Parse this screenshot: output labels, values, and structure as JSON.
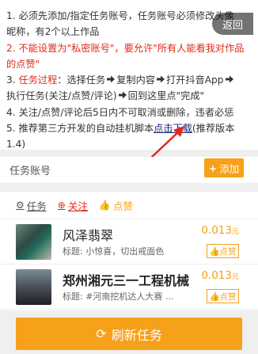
{
  "notice": {
    "line1_a": "1. 必须先添加/指定任务账号，任务账号必须修改头像",
    "line1_b": "昵称，有2个以上作品",
    "line2_a": "2. 不能设置为\"私密账号\"，要允许\"所有人能看我对作品",
    "line2_b": "的点赞\"",
    "line3_prefix": "3. ",
    "line3_tag": "任务过程",
    "line3_a": "：选择任务",
    "line3_b": "复制内容",
    "line3_c": "打开抖音App",
    "line4_a": "执行任务(关注/点赞/评论)",
    "line4_b": "回到这里点\"完成\"",
    "line5": "4. 关注/点赞/评论后5日内不可取消或删除，违者必惩",
    "line6_a": "5. 推荐第三方开发的自动挂机脚本",
    "line6_link": "点击下载",
    "line6_b": "(推荐版本",
    "line7": "1.4)"
  },
  "back_label": "返回",
  "account": {
    "title": "任务账号",
    "add_label": "添加"
  },
  "tabs": {
    "task": "任务",
    "follow": "关注",
    "like": "点赞"
  },
  "tasks": [
    {
      "title": "风泽翡翠",
      "subtitle": "标题: 小惊喜，切出戒面色",
      "price": "0.013",
      "unit": "元",
      "action": "点赞"
    },
    {
      "title": "郑州湘元三一工程机械",
      "subtitle": "标题: #河南挖机达人大赛 ...",
      "price": "0.013",
      "unit": "元",
      "action": "点赞"
    }
  ],
  "refresh_label": "刷新任务",
  "colors": {
    "accent": "#f7a01a",
    "red": "#e02a1a",
    "link": "#1a237e"
  }
}
